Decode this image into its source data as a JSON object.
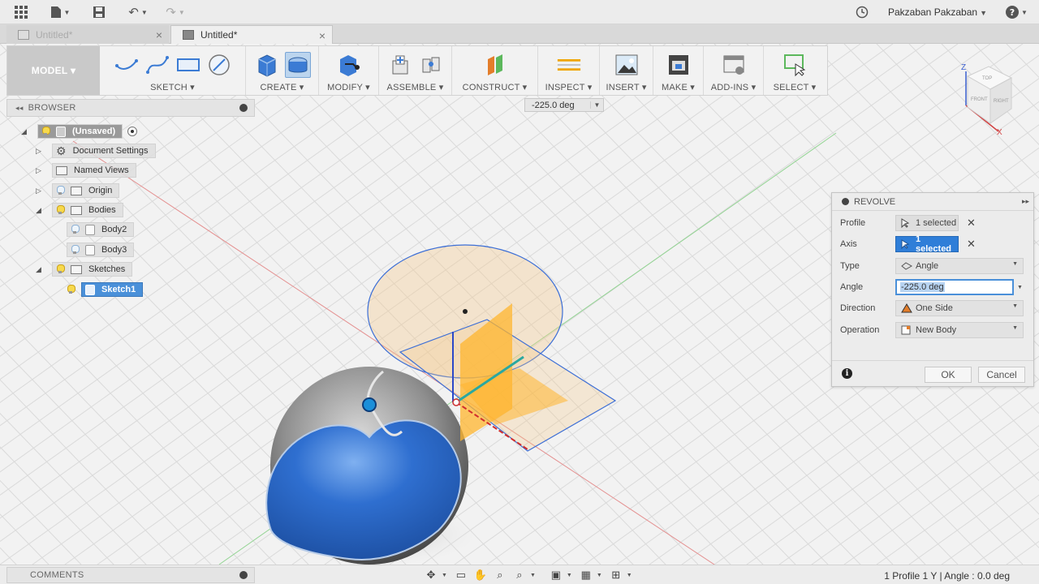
{
  "appbar": {
    "user_name": "Pakzaban Pakzaban",
    "icons": [
      "grid-icon",
      "file-icon",
      "save-icon",
      "undo-icon",
      "redo-icon",
      "clock-icon",
      "help-icon"
    ]
  },
  "tabs": [
    {
      "label": "Untitled*",
      "active": false
    },
    {
      "label": "Untitled*",
      "active": true
    }
  ],
  "toolbar": {
    "mode_label": "MODEL ▾",
    "groups": [
      {
        "label": "SKETCH ▾"
      },
      {
        "label": "CREATE ▾"
      },
      {
        "label": "MODIFY ▾"
      },
      {
        "label": "ASSEMBLE ▾"
      },
      {
        "label": "CONSTRUCT ▾"
      },
      {
        "label": "INSPECT ▾"
      },
      {
        "label": "INSERT ▾"
      },
      {
        "label": "MAKE ▾"
      },
      {
        "label": "ADD-INS ▾"
      },
      {
        "label": "SELECT ▾"
      }
    ]
  },
  "angle_float": {
    "value": "-225.0 deg"
  },
  "viewcube": {
    "labels": [
      "TOP",
      "FRONT",
      "RIGHT"
    ],
    "axes": [
      "Z",
      "X"
    ]
  },
  "browser": {
    "title": "BROWSER",
    "items": [
      {
        "label": "(Unsaved)"
      },
      {
        "label": "Document Settings"
      },
      {
        "label": "Named Views"
      },
      {
        "label": "Origin"
      },
      {
        "label": "Bodies"
      },
      {
        "label": "Body2"
      },
      {
        "label": "Body3"
      },
      {
        "label": "Sketches"
      },
      {
        "label": "Sketch1"
      }
    ]
  },
  "revolve": {
    "title": "REVOLVE",
    "rows": {
      "profile": {
        "label": "Profile",
        "value": "1 selected"
      },
      "axis": {
        "label": "Axis",
        "value": "1 selected"
      },
      "type": {
        "label": "Type",
        "value": "Angle"
      },
      "angle": {
        "label": "Angle",
        "value": "-225.0 deg"
      },
      "direction": {
        "label": "Direction",
        "value": "One Side"
      },
      "operation": {
        "label": "Operation",
        "value": "New Body"
      }
    },
    "ok_label": "OK",
    "cancel_label": "Cancel"
  },
  "bottom": {
    "comments_label": "COMMENTS",
    "status_text": "1 Profile 1 Y | Angle : 0.0 deg"
  },
  "colors": {
    "accent": "#2f7ed8",
    "profile_fill": "#f6c98a",
    "body_blue": "#2f6fd0",
    "body_grey": "#8a8a8a"
  }
}
